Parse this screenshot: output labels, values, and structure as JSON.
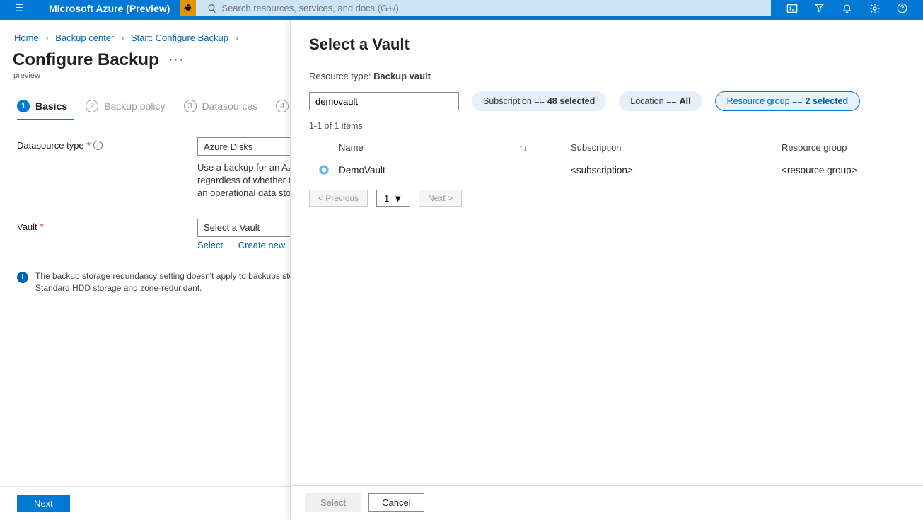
{
  "topbar": {
    "title": "Microsoft Azure (Preview)",
    "search_placeholder": "Search resources, services, and docs (G+/)"
  },
  "breadcrumb": {
    "items": [
      "Home",
      "Backup center",
      "Start: Configure Backup"
    ]
  },
  "page": {
    "title": "Configure Backup",
    "preview_label": "preview"
  },
  "wizard": {
    "steps": [
      {
        "num": "1",
        "label": "Basics"
      },
      {
        "num": "2",
        "label": "Backup policy"
      },
      {
        "num": "3",
        "label": "Datasources"
      },
      {
        "num": "4",
        "label": ""
      }
    ]
  },
  "form": {
    "datasource_label": "Datasource type",
    "datasource_value": "Azure Disks",
    "description": "Use a backup for an Azure Disk. Assign backup policy to the disk regardless of whether the disk is attached. Provides agentless backup to an operational data store.",
    "vault_label": "Vault",
    "vault_value": "Select a Vault",
    "select_link": "Select",
    "create_link": "Create new",
    "info_text": "The backup storage redundancy setting doesn't apply to backups stored in the operational data store use Standard HDD storage and zone-redundant."
  },
  "main_footer": {
    "next": "Next"
  },
  "panel": {
    "title": "Select a Vault",
    "resource_type_label": "Resource type:",
    "resource_type_value": "Backup vault",
    "filter_value": "demovault",
    "pills": {
      "sub_prefix": "Subscription ==",
      "sub_value": "48 selected",
      "loc_prefix": "Location ==",
      "loc_value": "All",
      "rg_prefix": "Resource group ==",
      "rg_value": "2 selected"
    },
    "count": "1-1 of 1 items",
    "columns": {
      "name": "Name",
      "sub": "Subscription",
      "rg": "Resource group"
    },
    "row": {
      "name": "DemoVault",
      "sub": "<subscription>",
      "rg": "<resource group>"
    },
    "pager": {
      "prev": "< Previous",
      "page": "1",
      "next": "Next >"
    },
    "footer": {
      "select": "Select",
      "cancel": "Cancel"
    }
  }
}
